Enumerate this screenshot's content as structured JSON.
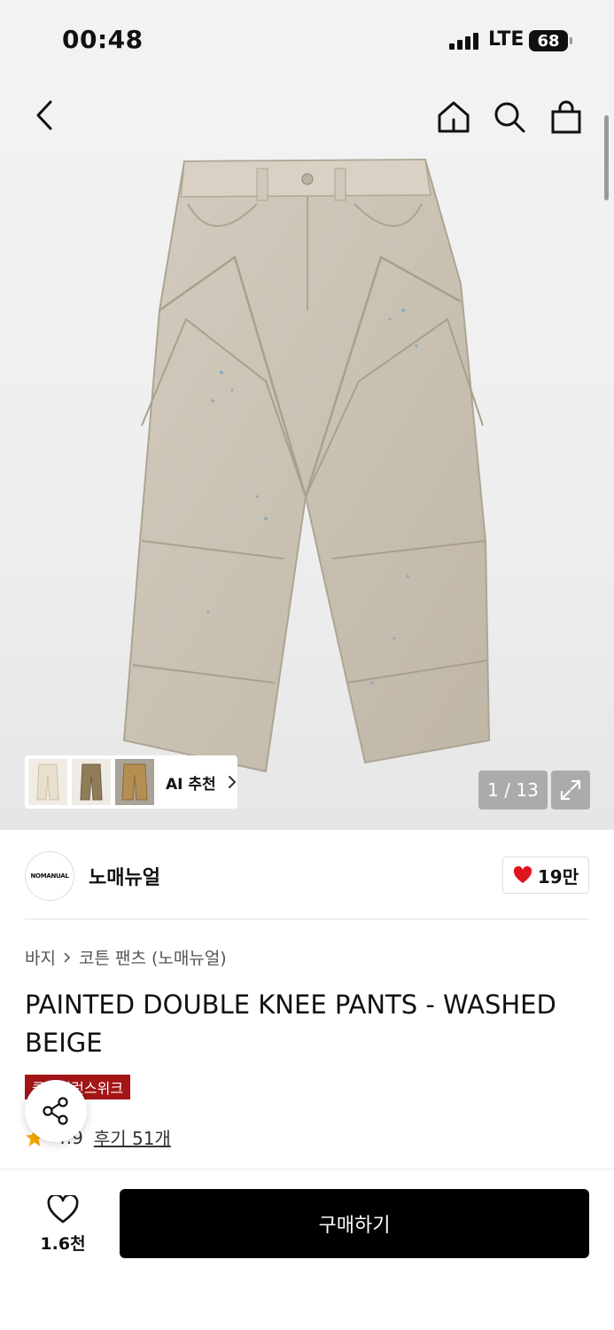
{
  "status_bar": {
    "time": "00:48",
    "network": "LTE",
    "battery": "68"
  },
  "gallery": {
    "counter": "1 / 13",
    "ai_label": "AI 추천",
    "thumbnails": [
      "thumbnail-beige",
      "thumbnail-khaki",
      "thumbnail-tan"
    ]
  },
  "brand": {
    "logo_text": "NOMANUAL",
    "name": "노매뉴얼",
    "likes": "19만"
  },
  "breadcrumb": {
    "category": "바지",
    "subcategory": "코튼 팬츠 (노매뉴얼)"
  },
  "product": {
    "title": "PAINTED DOUBLE KNEE PANTS - WASHED BEIGE",
    "badge": "클리어런스위크",
    "rating": "4.9",
    "reviews": "후기 51개"
  },
  "bottom": {
    "wish_count": "1.6천",
    "buy_label": "구매하기"
  },
  "colors": {
    "buy_button": "#000000",
    "badge": "#a31517",
    "heart": "#e0141e",
    "star": "#f5a800"
  }
}
